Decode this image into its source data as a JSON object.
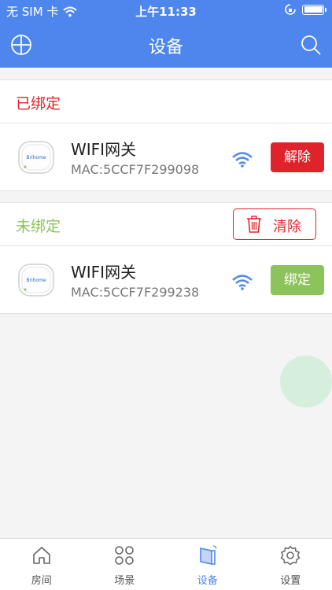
{
  "status_bar": {
    "carrier": "无 SIM 卡",
    "time": "上午11:33"
  },
  "nav": {
    "title": "设备",
    "left_icon": "add-circle-icon",
    "right_icon": "search-icon"
  },
  "bound_section": {
    "label": "已绑定",
    "devices": [
      {
        "name": "WIFI网关",
        "mac": "MAC:5CCF7F299098",
        "action_label": "解除"
      }
    ]
  },
  "unbound_section": {
    "label": "未绑定",
    "clear_label": "清除",
    "devices": [
      {
        "name": "WIFI网关",
        "mac": "MAC:5CCF7F299238",
        "action_label": "绑定"
      }
    ]
  },
  "tabs": [
    {
      "label": "房间",
      "icon": "home-icon",
      "active": false
    },
    {
      "label": "场景",
      "icon": "grid-icon",
      "active": false
    },
    {
      "label": "设备",
      "icon": "device-icon",
      "active": true
    },
    {
      "label": "设置",
      "icon": "gear-icon",
      "active": false
    }
  ],
  "colors": {
    "accent": "#4f86ee",
    "danger": "#e0232b",
    "success": "#8cc35a"
  }
}
